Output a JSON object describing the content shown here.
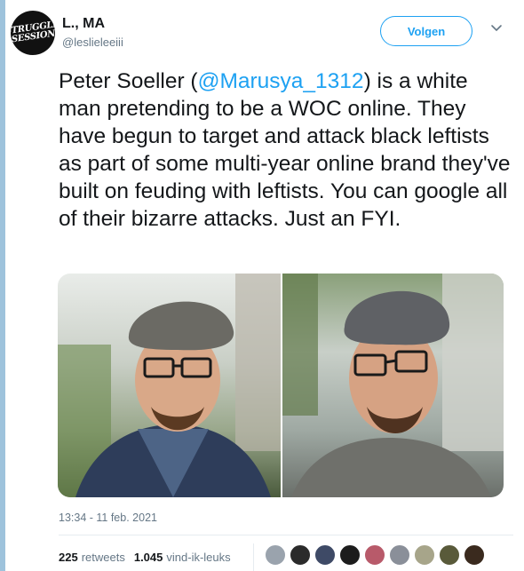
{
  "user": {
    "display_name": "L., MA",
    "handle": "@leslieleeiii",
    "avatar_text": [
      "STRUGGLE",
      "SESSION"
    ]
  },
  "follow_button": {
    "label": "Volgen"
  },
  "tweet": {
    "text_before": "Peter Soeller (",
    "mention": "@Marusya_1312",
    "text_after": ") is a white man pretending to be a WOC online. They have begun to target and attack black leftists as part of some multi-year online brand they've built on feuding with leftists. You can google all of their bizarre attacks. Just an FYI."
  },
  "timestamp": "13:34 - 11 feb. 2021",
  "stats": {
    "retweets_count": "225",
    "retweets_label": "retweets",
    "likes_count": "1.045",
    "likes_label": "vind-ik-leuks"
  },
  "liker_avatars": [
    {
      "color": "#9aa3ad"
    },
    {
      "color": "#2b2b2b"
    },
    {
      "color": "#3e4a66"
    },
    {
      "color": "#1c1c1c"
    },
    {
      "color": "#b85a6a"
    },
    {
      "color": "#8a8f99"
    },
    {
      "color": "#a7a58a"
    },
    {
      "color": "#595a3a"
    },
    {
      "color": "#3a2a1e"
    }
  ],
  "colors": {
    "accent": "#1da1f2",
    "text": "#14171a",
    "muted": "#657786"
  }
}
